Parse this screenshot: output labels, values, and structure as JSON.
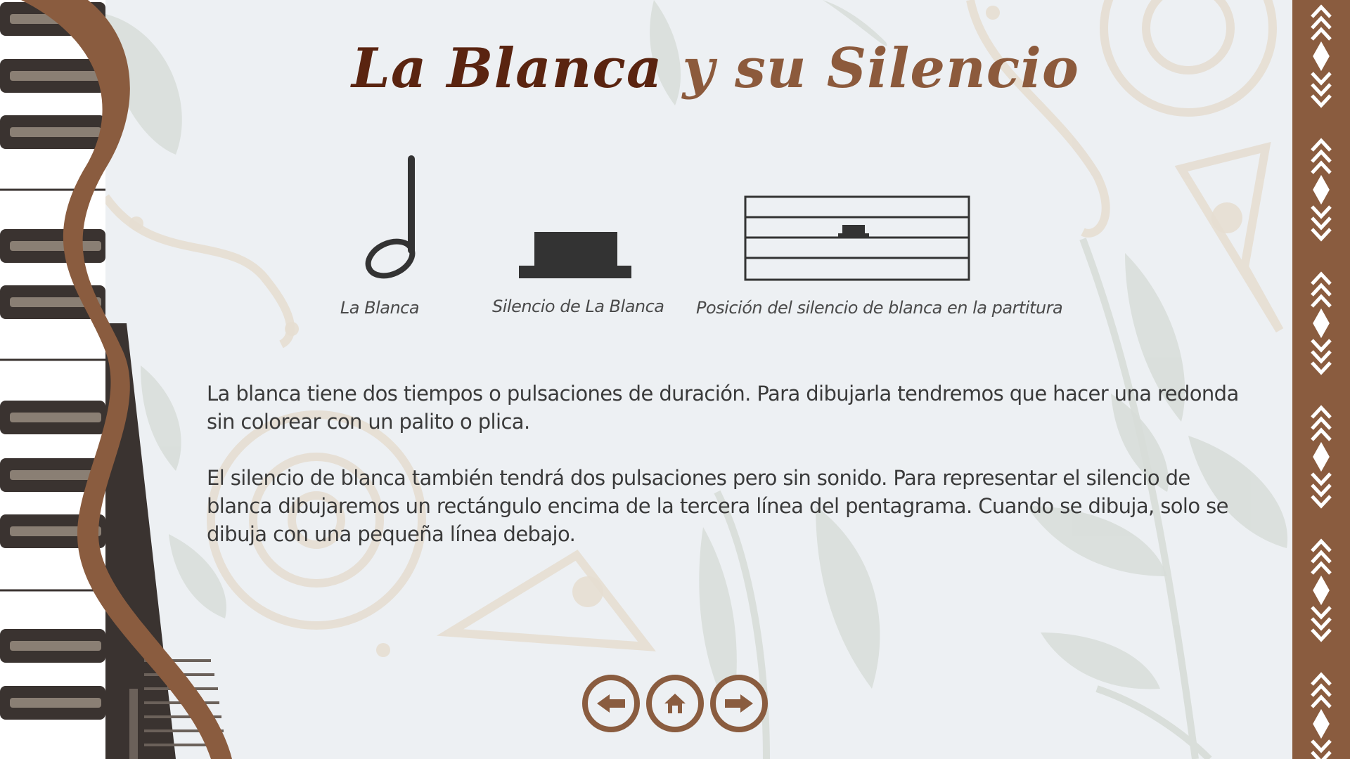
{
  "slide": {
    "title_part1": "La Blanca",
    "title_part2": " y su Silencio"
  },
  "figures": {
    "note_caption": "La Blanca",
    "rest_caption": "Silencio de La Blanca",
    "staff_caption": "Posición del silencio de blanca en la partitura"
  },
  "body": {
    "paragraph1": "La blanca tiene dos tiempos o pulsaciones de duración. Para dibujarla tendremos que hacer una redonda sin colorear con un palito o plica.",
    "paragraph2": "El silencio de blanca también tendrá dos pulsaciones pero sin sonido. Para representar el silencio de blanca dibujaremos un rectángulo encima de la tercera línea del pentagrama. Cuando se dibuja, solo se dibuja con una pequeña línea debajo."
  },
  "navigation": {
    "prev_icon": "arrow-left-icon",
    "home_icon": "home-icon",
    "next_icon": "arrow-right-icon"
  },
  "colors": {
    "background": "#edf0f3",
    "brown_accent": "#8a5c3f",
    "title_dark": "#5a2410",
    "title_light": "#8c5a3c",
    "text": "#3a3a3a"
  }
}
